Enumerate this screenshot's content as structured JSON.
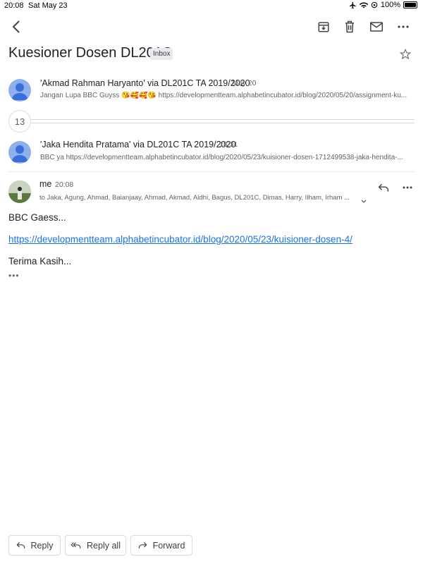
{
  "status_bar": {
    "time": "20:08",
    "date": "Sat May 23",
    "battery": "100%"
  },
  "toolbar": {
    "icons": [
      "back-arrow-icon",
      "archive-icon",
      "trash-icon",
      "mail-icon",
      "more-vert-icon"
    ]
  },
  "thread": {
    "subject": "Kuesioner Dosen DL201C",
    "label": "Inbox",
    "collapsed_count": "13"
  },
  "messages": [
    {
      "sender": "'Akmad Rahman Haryanto' via DL201C TA 2019/2020",
      "date": "May 20",
      "snippet": "Jangan Lupa BBC Guyss 😘🥰🥰😘 https://developmentteam.alphabetincubator.id/blog/2020/05/20/assignment-ku..."
    },
    {
      "sender": "'Jaka Hendita Pratama' via DL201C TA 2019/2020",
      "date": "18:31",
      "snippet": "BBC ya https://developmentteam.alphabetincubator.id/blog/2020/05/23/kuisioner-dosen-1712499538-jaka-hendita-..."
    }
  ],
  "open_message": {
    "sender": "me",
    "time": "20:08",
    "to": "to Jaka, Agung, Ahmad, Baianjaay, Ahmad, Akmad, Aldhi, Bagus, DL201C, Dimas, Harry, Ilham, Irham ...",
    "body_line1": "BBC Gaess...",
    "link": "https://developmentteam.alphabetincubator.id/blog/2020/05/23/kuisioner-dosen-4/",
    "body_line2": "Terima Kasih...",
    "trimmed": "•••"
  },
  "actions": {
    "reply": "Reply",
    "reply_all": "Reply all",
    "forward": "Forward"
  },
  "colors": {
    "link": "#1a73e8",
    "avatar": "#8fb0ec",
    "text": "#202124",
    "muted": "#5f6368"
  }
}
